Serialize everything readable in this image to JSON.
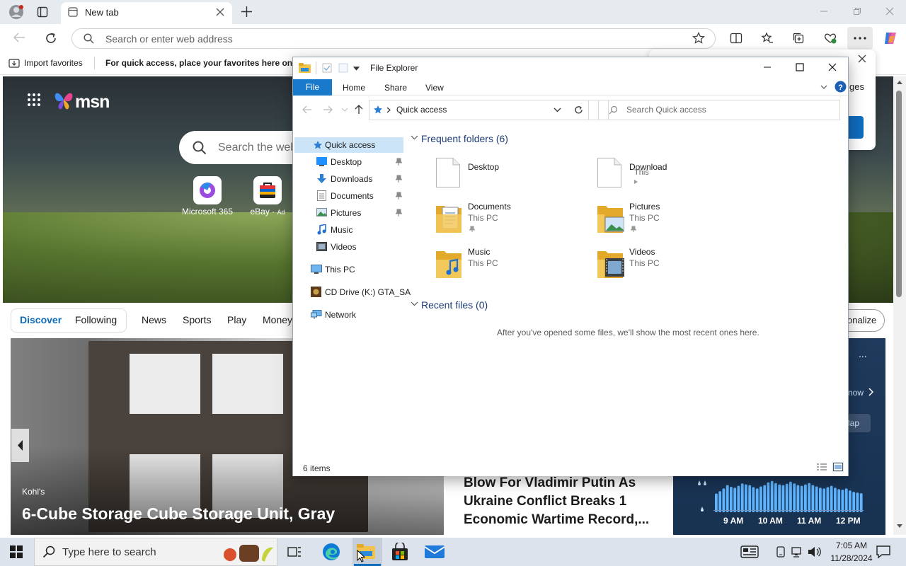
{
  "browser": {
    "tab_title": "New tab",
    "address_placeholder": "Search or enter web address",
    "favorites": {
      "import_label": "Import favorites",
      "hint_text": "For quick access, place your favorites here on the"
    }
  },
  "msn": {
    "logo_text": "msn",
    "search_placeholder": "Search the web",
    "quicklinks": [
      {
        "label": "Microsoft 365"
      },
      {
        "label": "eBay",
        "ad": "Ad"
      }
    ],
    "feed_tabs": [
      "Discover",
      "Following"
    ],
    "nav_items": [
      "News",
      "Sports",
      "Play",
      "Money"
    ],
    "personalize_label": "onalize",
    "story": {
      "source": "Kohl's",
      "title": "6-Cube Storage Cube Storage Unit, Gray"
    },
    "news_card": {
      "title": "Blow For Vladimir Putin As Ukraine Conflict Breaks 1 Economic Wartime Record,..."
    },
    "weather": {
      "more": "...",
      "now_label": "now",
      "map_label": "lap",
      "hours": [
        "9 AM",
        "10 AM",
        "11 AM",
        "12 PM"
      ],
      "bars": [
        0.55,
        0.62,
        0.7,
        0.8,
        0.75,
        0.72,
        0.78,
        0.85,
        0.82,
        0.8,
        0.74,
        0.7,
        0.76,
        0.8,
        0.88,
        0.92,
        0.86,
        0.82,
        0.8,
        0.84,
        0.9,
        0.85,
        0.8,
        0.78,
        0.82,
        0.86,
        0.8,
        0.76,
        0.72,
        0.7,
        0.74,
        0.78,
        0.72,
        0.68,
        0.66,
        0.7,
        0.64,
        0.6,
        0.58,
        0.56
      ]
    }
  },
  "popup": {
    "partial_text": "ges"
  },
  "explorer": {
    "title": "File Explorer",
    "ribbon_tabs": [
      "File",
      "Home",
      "Share",
      "View"
    ],
    "path": "Quick access",
    "search_placeholder": "Search Quick access",
    "nav": {
      "quick_access": "Quick access",
      "pinned": [
        "Desktop",
        "Downloads",
        "Documents",
        "Pictures"
      ],
      "unpinned": [
        "Music",
        "Videos"
      ],
      "this_pc": "This PC",
      "cd_drive": "CD Drive (K:) GTA_SA",
      "network": "Network"
    },
    "frequent_header": "Frequent folders (6)",
    "folders": [
      {
        "name": "Desktop",
        "sub": ""
      },
      {
        "name": "Download",
        "sub": "This"
      },
      {
        "name": "Documents",
        "sub": "This PC"
      },
      {
        "name": "Pictures",
        "sub": "This PC"
      },
      {
        "name": "Music",
        "sub": "This PC"
      },
      {
        "name": "Videos",
        "sub": "This PC"
      }
    ],
    "recent_header": "Recent files (0)",
    "recent_empty": "After you've opened some files, we'll show the most recent ones here.",
    "status": "6 items"
  },
  "taskbar": {
    "search_placeholder": "Type here to search",
    "time": "7:05 AM",
    "date": "11/28/2024"
  },
  "colors": {
    "accent": "#1979ca",
    "edge_blue": "#0f6cbd",
    "msn_pill_blue": "#0f6cbd"
  }
}
